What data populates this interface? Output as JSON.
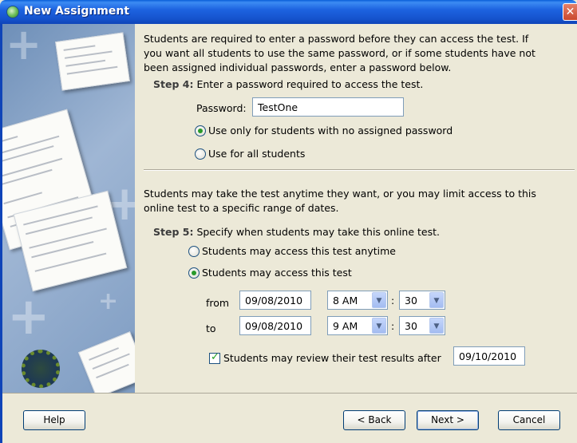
{
  "window": {
    "title": "New Assignment",
    "close_glyph": "✕"
  },
  "intro": {
    "line1": "Students are required to enter a password before they can access the test.  If",
    "line2": "you want all students to use the same password, or if some students have not",
    "line3": "been assigned individual passwords, enter a password below."
  },
  "step4": {
    "label": "Step 4:",
    "text": "Enter a password required to access the test.",
    "password_label": "Password:",
    "password_value": "TestOne",
    "options": [
      {
        "label": "Use only for students with no assigned password",
        "checked": true
      },
      {
        "label": "Use for all students",
        "checked": false
      }
    ]
  },
  "access_intro": {
    "line1": "Students may take the test anytime they want, or you may limit access to this",
    "line2": "online test to a specific range of dates."
  },
  "step5": {
    "label": "Step 5:",
    "text": "Specify when students may take this online test.",
    "options": [
      {
        "label": "Students may access this test anytime",
        "checked": false
      },
      {
        "label": "Students may access this test",
        "checked": true
      }
    ],
    "from_label": "from",
    "to_label": "to",
    "from_date": "09/08/2010",
    "from_hour": "8 AM",
    "from_minute": "30",
    "to_date": "09/08/2010",
    "to_hour": "9 AM",
    "to_minute": "30",
    "colon": ":",
    "review_label": "Students may review their test results after",
    "review_checked": true,
    "review_date": "09/10/2010"
  },
  "buttons": {
    "help": "Help",
    "back": "< Back",
    "next": "Next >",
    "cancel": "Cancel"
  },
  "icons": {
    "dropdown": "chevron-down-icon",
    "app": "app-globe-icon",
    "close": "close-icon"
  }
}
